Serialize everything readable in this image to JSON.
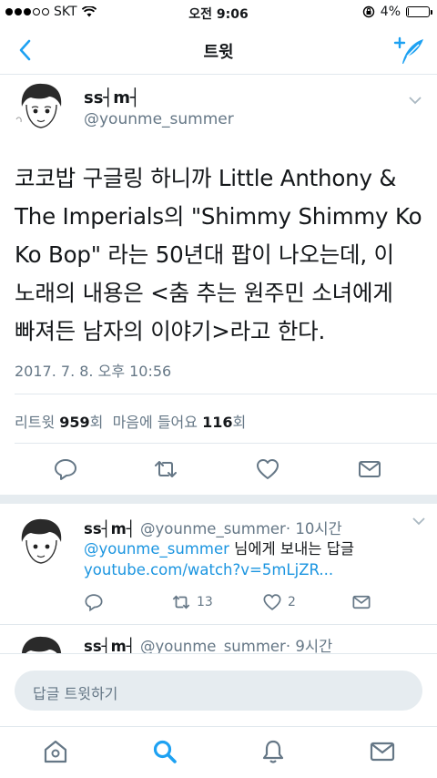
{
  "status_bar": {
    "carrier": "SKT",
    "time": "오전 9:06",
    "battery": "4%",
    "battery_level": 0.04
  },
  "nav": {
    "title": "트윗",
    "back_icon": "chevron-left-icon",
    "compose_icon": "compose-tweet-icon"
  },
  "main_tweet": {
    "name": "ss┤m┤",
    "handle": "@younme_summer",
    "text_lines": [
      "코코밥 구글링 하니까 Little Anthony &",
      "The Imperials의 \"Shimmy Shimmy Ko",
      "Ko Bop\" 라는 50년대 팝이 나오는데, 이",
      "노래의 내용은 <춤 추는 원주민 소녀에게",
      "빠져든 남자의 이야기>라고 한다."
    ],
    "date": "2017. 7. 8. 오후 10:56",
    "retweets_label": "리트윗",
    "retweets_count": "959",
    "retweets_suffix": "회",
    "likes_label": "마음에 들어요",
    "likes_count": "116",
    "likes_suffix": "회"
  },
  "replies": [
    {
      "name": "ss┤m┤",
      "handle": "@younme_summer",
      "time": "· 10시간",
      "reply_to_handle": "@younme_summer",
      "reply_to_suffix": " 님에게 보내는 답글",
      "link": "youtube.com/watch?v=5mLjZR...",
      "retweet_count": "13",
      "like_count": "2"
    },
    {
      "name": "ss┤m┤",
      "handle": "@younme_summer",
      "time": "· 9시간"
    }
  ],
  "reply_bar": {
    "placeholder": "답글 트윗하기"
  },
  "tab_bar": {
    "items": [
      "home-icon",
      "search-icon",
      "notifications-icon",
      "messages-icon"
    ],
    "active": "search-icon"
  },
  "colors": {
    "accent": "#1da1f2",
    "text": "#14171a",
    "secondary": "#657786",
    "divider": "#e1e8ed"
  }
}
